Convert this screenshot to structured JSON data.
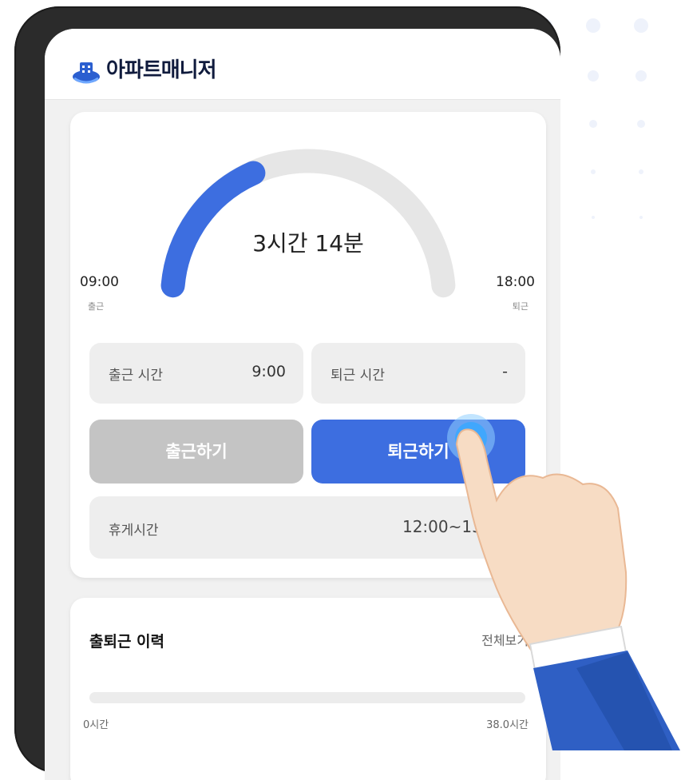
{
  "app": {
    "title": "아파트매니저"
  },
  "gauge": {
    "elapsed_text": "3시간 14분",
    "progress_fraction": 0.36,
    "start_time": "09:00",
    "start_label": "출근",
    "end_time": "18:00",
    "end_label": "퇴근",
    "track_color": "#e6e6e6",
    "fill_color": "#3d6ee0"
  },
  "clock_in": {
    "label": "출근 시간",
    "value": "9:00"
  },
  "clock_out": {
    "label": "퇴근 시간",
    "value": "-"
  },
  "buttons": {
    "check_in": "출근하기",
    "check_out": "퇴근하기"
  },
  "break_time": {
    "label": "휴게시간",
    "value": "12:00~13:00"
  },
  "history": {
    "title": "출퇴근 이력",
    "view_all": "전체보기",
    "progress_fraction": 0,
    "min_label": "0시간",
    "max_label": "38.0시간"
  },
  "icons": {
    "logo": "apartment-building-icon",
    "hand": "pointing-hand-icon"
  },
  "colors": {
    "accent": "#3d6ee0",
    "disabled_button": "#c4c4c4",
    "phone_frame": "#2b2b2b"
  }
}
